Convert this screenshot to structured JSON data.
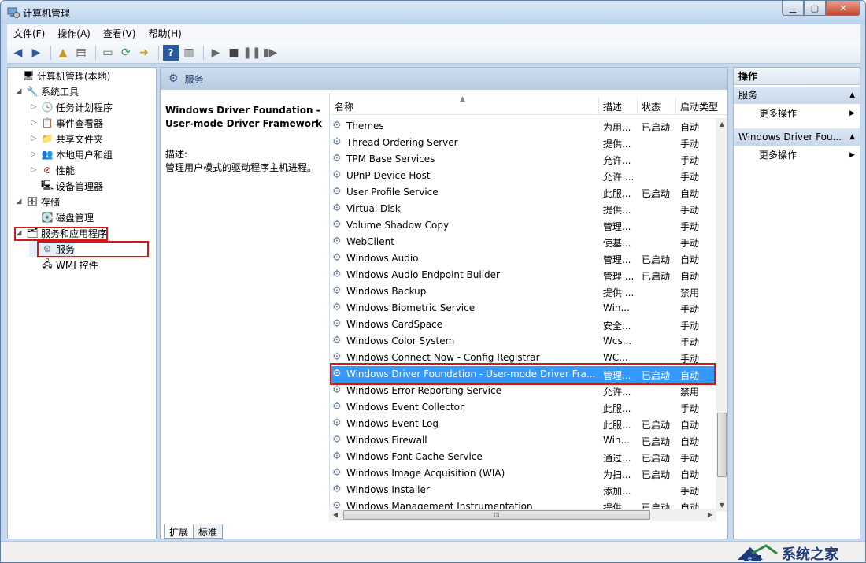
{
  "window": {
    "title": "计算机管理"
  },
  "menu": [
    "文件(F)",
    "操作(A)",
    "查看(V)",
    "帮助(H)"
  ],
  "tree": [
    {
      "label": "计算机管理(本地)",
      "icon": "computer-icon",
      "level": 0,
      "toggle": ""
    },
    {
      "label": "系统工具",
      "icon": "tools-icon",
      "level": 1,
      "toggle": "◢"
    },
    {
      "label": "任务计划程序",
      "icon": "clock-icon",
      "level": 2,
      "toggle": "▷"
    },
    {
      "label": "事件查看器",
      "icon": "event-viewer-icon",
      "level": 2,
      "toggle": "▷"
    },
    {
      "label": "共享文件夹",
      "icon": "folder-icon",
      "level": 2,
      "toggle": "▷"
    },
    {
      "label": "本地用户和组",
      "icon": "users-icon",
      "level": 2,
      "toggle": "▷"
    },
    {
      "label": "性能",
      "icon": "performance-icon",
      "level": 2,
      "toggle": "▷"
    },
    {
      "label": "设备管理器",
      "icon": "device-manager-icon",
      "level": 2,
      "toggle": ""
    },
    {
      "label": "存储",
      "icon": "storage-icon",
      "level": 1,
      "toggle": "◢"
    },
    {
      "label": "磁盘管理",
      "icon": "disk-icon",
      "level": 2,
      "toggle": ""
    },
    {
      "label": "服务和应用程序",
      "icon": "services-apps-icon",
      "level": 1,
      "toggle": "◢"
    },
    {
      "label": "服务",
      "icon": "gear-icon",
      "level": 2,
      "toggle": ""
    },
    {
      "label": "WMI 控件",
      "icon": "wmi-icon",
      "level": 2,
      "toggle": ""
    }
  ],
  "center": {
    "header": "服务",
    "desc_title": "Windows Driver Foundation - User-mode Driver Framework",
    "desc_label": "描述:",
    "desc_text": "管理用户模式的驱动程序主机进程。",
    "columns": [
      "名称",
      "描述",
      "状态",
      "启动类型"
    ],
    "rows": [
      {
        "name": "Themes",
        "desc": "为用...",
        "status": "已启动",
        "startup": "自动"
      },
      {
        "name": "Thread Ordering Server",
        "desc": "提供...",
        "status": "",
        "startup": "手动"
      },
      {
        "name": "TPM Base Services",
        "desc": "允许...",
        "status": "",
        "startup": "手动"
      },
      {
        "name": "UPnP Device Host",
        "desc": "允许 ...",
        "status": "",
        "startup": "手动"
      },
      {
        "name": "User Profile Service",
        "desc": "此服...",
        "status": "已启动",
        "startup": "自动"
      },
      {
        "name": "Virtual Disk",
        "desc": "提供...",
        "status": "",
        "startup": "手动"
      },
      {
        "name": "Volume Shadow Copy",
        "desc": "管理...",
        "status": "",
        "startup": "手动"
      },
      {
        "name": "WebClient",
        "desc": "使基...",
        "status": "",
        "startup": "手动"
      },
      {
        "name": "Windows Audio",
        "desc": "管理...",
        "status": "已启动",
        "startup": "自动"
      },
      {
        "name": "Windows Audio Endpoint Builder",
        "desc": "管理 ...",
        "status": "已启动",
        "startup": "自动"
      },
      {
        "name": "Windows Backup",
        "desc": "提供 ...",
        "status": "",
        "startup": "禁用"
      },
      {
        "name": "Windows Biometric Service",
        "desc": "Win...",
        "status": "",
        "startup": "手动"
      },
      {
        "name": "Windows CardSpace",
        "desc": "安全...",
        "status": "",
        "startup": "手动"
      },
      {
        "name": "Windows Color System",
        "desc": "Wcs...",
        "status": "",
        "startup": "手动"
      },
      {
        "name": "Windows Connect Now - Config Registrar",
        "desc": "WC...",
        "status": "",
        "startup": "手动"
      },
      {
        "name": "Windows Driver Foundation - User-mode Driver Fra...",
        "desc": "管理...",
        "status": "已启动",
        "startup": "自动"
      },
      {
        "name": "Windows Error Reporting Service",
        "desc": "允许...",
        "status": "",
        "startup": "禁用"
      },
      {
        "name": "Windows Event Collector",
        "desc": "此服...",
        "status": "",
        "startup": "手动"
      },
      {
        "name": "Windows Event Log",
        "desc": "此服...",
        "status": "已启动",
        "startup": "自动"
      },
      {
        "name": "Windows Firewall",
        "desc": "Win...",
        "status": "已启动",
        "startup": "自动"
      },
      {
        "name": "Windows Font Cache Service",
        "desc": "通过...",
        "status": "已启动",
        "startup": "手动"
      },
      {
        "name": "Windows Image Acquisition (WIA)",
        "desc": "为扫...",
        "status": "已启动",
        "startup": "自动"
      },
      {
        "name": "Windows Installer",
        "desc": "添加...",
        "status": "",
        "startup": "手动"
      },
      {
        "name": "Windows Management Instrumentation",
        "desc": "提供...",
        "status": "已启动",
        "startup": "自动"
      }
    ],
    "selected_row": 15,
    "tabs": [
      "扩展",
      "标准"
    ]
  },
  "actions": {
    "title": "操作",
    "section1": "服务",
    "more1": "更多操作",
    "section2": "Windows Driver Fou...",
    "more2": "更多操作"
  },
  "watermark": {
    "text": "系统之家"
  },
  "colors": {
    "selection": "#3399ff",
    "highlight": "#d11919",
    "accent": "#1f3c7a"
  }
}
